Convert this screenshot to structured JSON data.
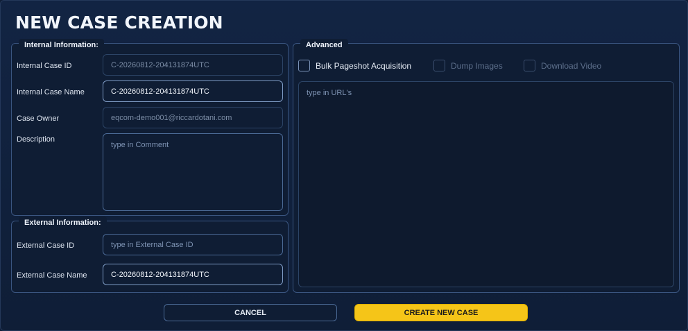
{
  "title": "NEW CASE CREATION",
  "internal": {
    "label": "Internal Information:",
    "case_id_label": "Internal Case ID",
    "case_id_value": "C-20260812-204131874UTC",
    "case_name_label": "Internal Case Name",
    "case_name_value": "C-20260812-204131874UTC",
    "owner_label": "Case Owner",
    "owner_value": "eqcom-demo001@riccardotani.com",
    "description_label": "Description",
    "description_placeholder": "type in Comment"
  },
  "external": {
    "label": "External Information:",
    "case_id_label": "External Case ID",
    "case_id_placeholder": "type in External Case ID",
    "case_name_label": "External Case Name",
    "case_name_value": "C-20260812-204131874UTC"
  },
  "advanced": {
    "label": "Advanced",
    "options": {
      "bulk_pageshot": {
        "label": "Bulk Pageshot Acquisition",
        "checked": false,
        "enabled": true
      },
      "dump_images": {
        "label": "Dump Images",
        "checked": false,
        "enabled": false
      },
      "download_video": {
        "label": "Download Video",
        "checked": false,
        "enabled": false
      }
    },
    "urls_placeholder": "type in URL's"
  },
  "buttons": {
    "cancel": "CANCEL",
    "create": "CREATE NEW CASE"
  },
  "colors": {
    "background": "#0f1e36",
    "accent": "#f5c518",
    "border": "#4b6a96"
  }
}
